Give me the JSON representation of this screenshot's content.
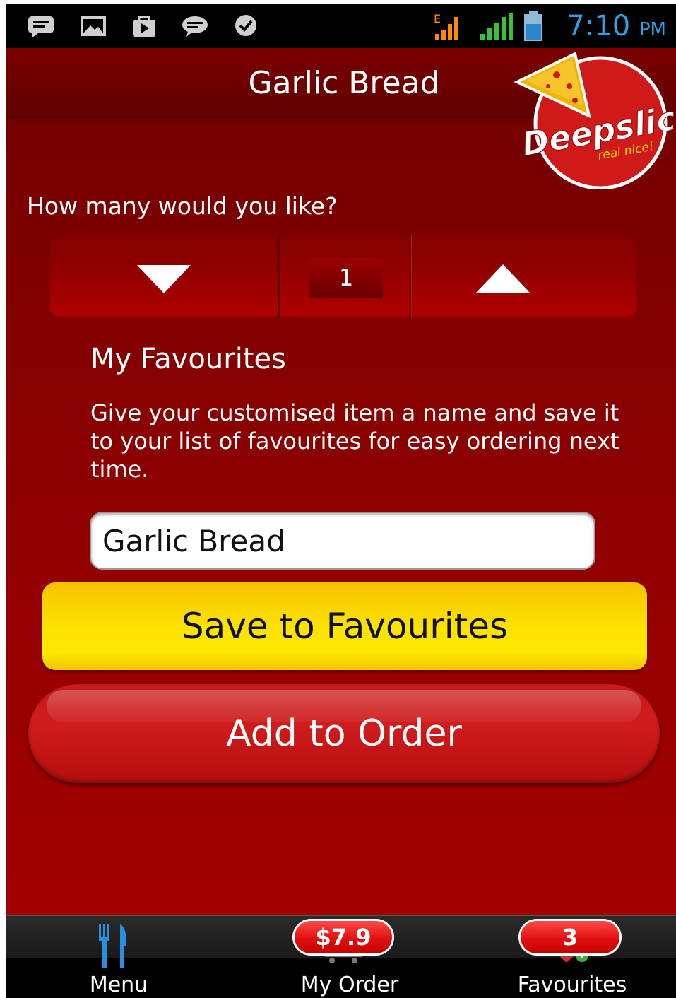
{
  "status_bar": {
    "time": "7:10",
    "ampm": "PM",
    "notification_icons": [
      "sms-icon",
      "gallery-icon",
      "store-icon",
      "chat-icon",
      "bbm-icon"
    ],
    "network": "E",
    "time_color": "#2aa3e6"
  },
  "header": {
    "title": "Garlic Bread",
    "logo_text": "Deepslice",
    "logo_tagline": "real nice!"
  },
  "quantity": {
    "prompt": "How many would you like?",
    "value": "1"
  },
  "favourites": {
    "title": "My Favourites",
    "description": "Give your customised item a name and save it to your list of favourites for easy ordering next time.",
    "name_value": "Garlic Bread",
    "save_label": "Save to Favourites"
  },
  "order": {
    "add_label": "Add to Order"
  },
  "bottom_nav": {
    "menu_label": "Menu",
    "order_label": "My Order",
    "order_total": "$7.9",
    "favourites_label": "Favourites",
    "favourites_count": "3"
  },
  "colors": {
    "brand_red": "#a70000",
    "save_yellow": "#fbe200",
    "add_red": "#d11c1c"
  }
}
